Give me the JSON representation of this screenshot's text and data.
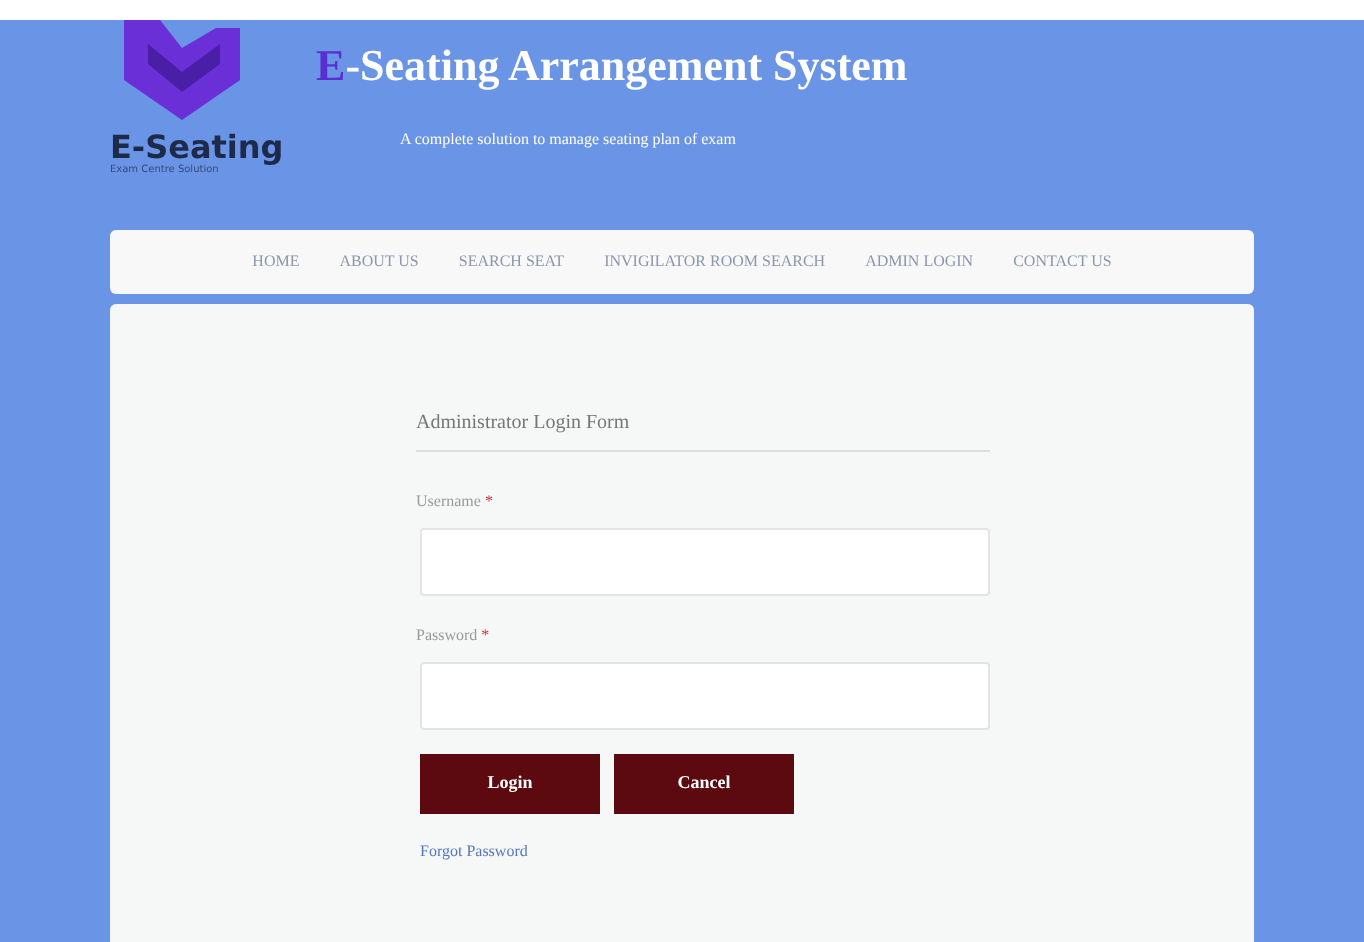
{
  "header": {
    "logo_text": "E-Seating",
    "logo_tagline": "Exam Centre Solution",
    "title_accent": "E",
    "title_rest": "-Seating Arrangement System",
    "subtitle": "A complete solution to manage seating plan of exam"
  },
  "nav": [
    {
      "label": "HOME"
    },
    {
      "label": "ABOUT US"
    },
    {
      "label": "SEARCH SEAT"
    },
    {
      "label": "INVIGILATOR ROOM SEARCH"
    },
    {
      "label": "ADMIN LOGIN"
    },
    {
      "label": "CONTACT US"
    }
  ],
  "form": {
    "heading": "Administrator Login Form",
    "fields": [
      {
        "label": "Username",
        "required_mark": "*"
      },
      {
        "label": "Password",
        "required_mark": "*"
      }
    ],
    "buttons": [
      "Login",
      "Cancel"
    ],
    "link": "Forgot Password"
  }
}
